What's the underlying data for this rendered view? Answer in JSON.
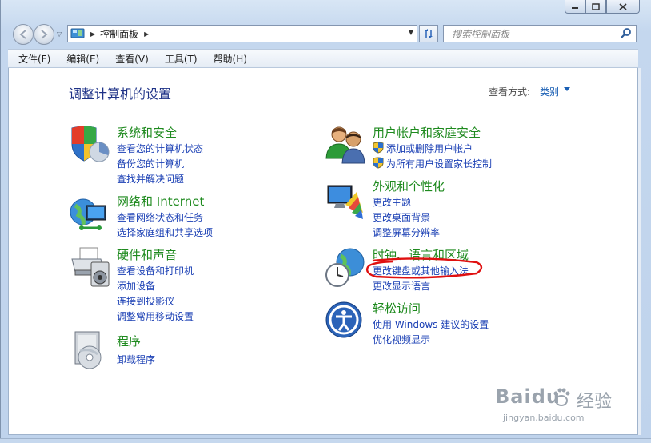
{
  "window": {
    "minimize_icon": "minimize-icon",
    "maximize_icon": "maximize-icon",
    "close_icon": "close-icon"
  },
  "address_bar": {
    "breadcrumb": "控制面板",
    "search_placeholder": "搜索控制面板"
  },
  "menu": [
    "文件(F)",
    "编辑(E)",
    "查看(V)",
    "工具(T)",
    "帮助(H)"
  ],
  "header": {
    "title": "调整计算机的设置",
    "view_by_label": "查看方式:",
    "view_by_value": "类别"
  },
  "categories": [
    {
      "title": "系统和安全",
      "links": [
        "查看您的计算机状态",
        "备份您的计算机",
        "查找并解决问题"
      ]
    },
    {
      "title": "网络和 Internet",
      "links": [
        "查看网络状态和任务",
        "选择家庭组和共享选项"
      ]
    },
    {
      "title": "硬件和声音",
      "links": [
        "查看设备和打印机",
        "添加设备",
        "连接到投影仪",
        "调整常用移动设置"
      ]
    },
    {
      "title": "程序",
      "links": [
        "卸载程序"
      ]
    },
    {
      "title": "用户帐户和家庭安全",
      "links": [
        "添加或删除用户帐户",
        "为所有用户设置家长控制"
      ]
    },
    {
      "title": "外观和个性化",
      "links": [
        "更改主题",
        "更改桌面背景",
        "调整屏幕分辨率"
      ]
    },
    {
      "title": "时钟、语言和区域",
      "links": [
        "更改键盘或其他输入法",
        "更改显示语言"
      ]
    },
    {
      "title": "轻松访问",
      "links": [
        "使用 Windows 建议的设置",
        "优化视频显示"
      ]
    }
  ],
  "watermark": {
    "brand": "Baidu",
    "brand_cn": "经验",
    "url": "jingyan.baidu.com"
  },
  "colors": {
    "category_title": "#1e8a1e",
    "link": "#1a3fb4",
    "page_title": "#1e3287",
    "annotation": "#e01010"
  }
}
